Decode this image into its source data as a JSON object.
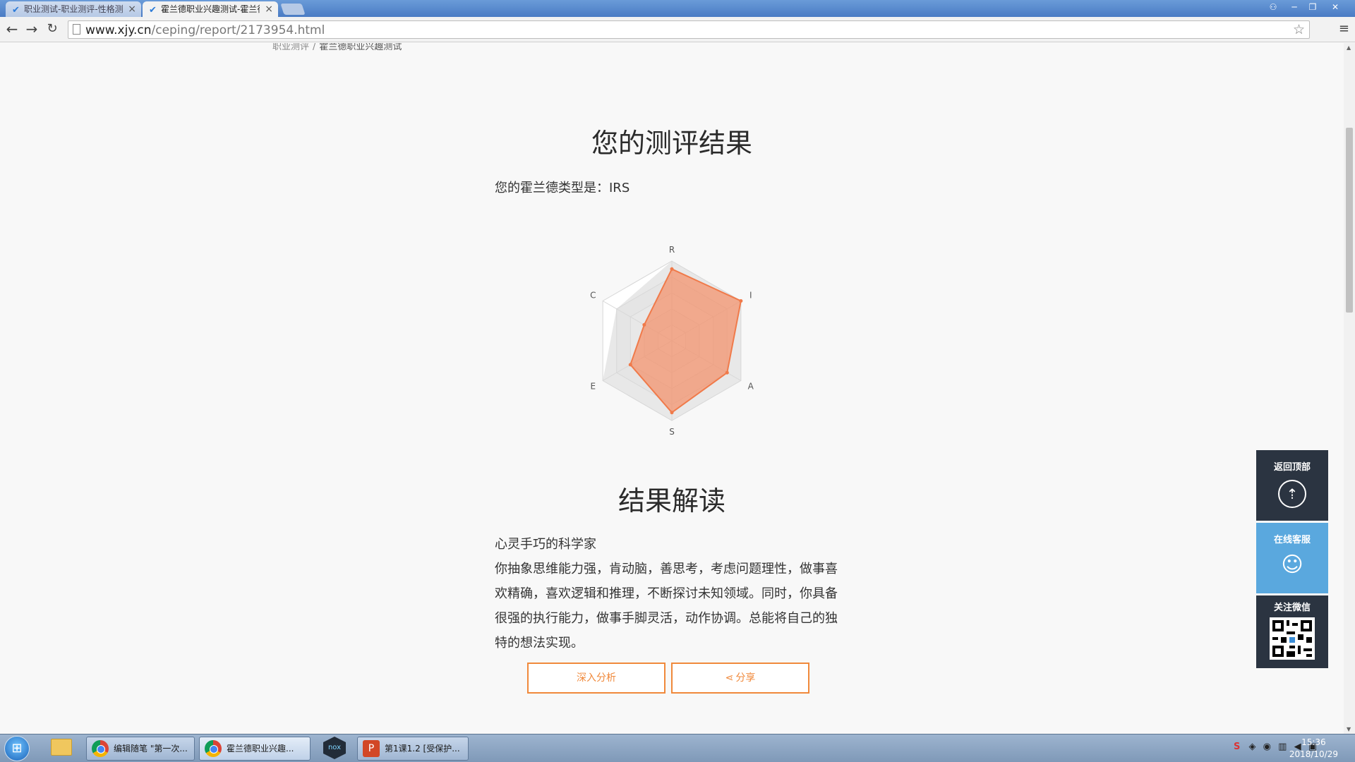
{
  "browser": {
    "tabs": [
      {
        "title": "职业测试-职业测评-性格测试",
        "state": "inactive"
      },
      {
        "title": "霍兰德职业兴趣测试-霍兰德",
        "state": "active"
      }
    ],
    "url_host": "www.xjy.cn",
    "url_path": "/ceping/report/2173954.html"
  },
  "breadcrumb": {
    "parent": "职业测评",
    "separator": "/",
    "current": "霍兰德职业兴趣测试"
  },
  "result": {
    "title": "您的测评结果",
    "type_line": "您的霍兰德类型是：IRS"
  },
  "chart_data": {
    "type": "radar",
    "axes": [
      "R",
      "I",
      "A",
      "S",
      "E",
      "C"
    ],
    "max": 5,
    "rings": 5,
    "series": [
      {
        "values": [
          4.5,
          5,
          4,
          4.5,
          3,
          2
        ],
        "color": "#f4906a"
      },
      {
        "values": [
          5,
          5,
          5,
          5,
          5,
          4
        ],
        "color": "#d8d8d8"
      }
    ]
  },
  "interpretation": {
    "title": "结果解读",
    "subtitle": "心灵手巧的科学家",
    "body": "你抽象思维能力强，肯动脑，善思考，考虑问题理性，做事喜欢精确，喜欢逻辑和推理，不断探讨未知领域。同时，你具备很强的执行能力，做事手脚灵活，动作协调。总能将自己的独特的想法实现。"
  },
  "buttons": {
    "analyze": "深入分析",
    "share": "分享"
  },
  "floating": {
    "back_top": "返回顶部",
    "service": "在线客服",
    "wechat": "关注微信"
  },
  "taskbar": {
    "items": [
      {
        "label": "编辑随笔 \"第一次..."
      },
      {
        "label": "霍兰德职业兴趣..."
      },
      {
        "label": "第1课1.2 [受保护..."
      }
    ],
    "time": "15:36",
    "date": "2018/10/29"
  }
}
